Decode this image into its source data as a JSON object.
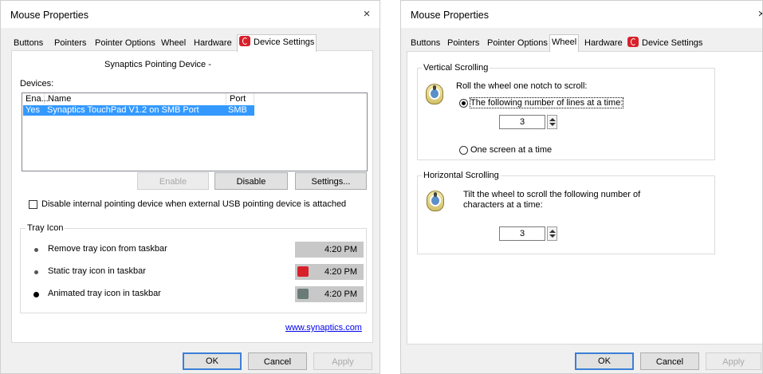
{
  "left": {
    "title": "Mouse Properties",
    "close_glyph": "×",
    "tabs": [
      "Buttons",
      "Pointers",
      "Pointer Options",
      "Wheel",
      "Hardware",
      "Device Settings"
    ],
    "device_title": "Synaptics Pointing Device -",
    "devices_label": "Devices:",
    "columns": [
      "Ena...",
      "Name",
      "Port"
    ],
    "rows": [
      {
        "enabled": "Yes",
        "name": "Synaptics TouchPad V1.2 on SMB Port",
        "port": "SMB"
      }
    ],
    "buttons": {
      "enable": "Enable",
      "disable": "Disable",
      "settings": "Settings..."
    },
    "checkbox_label": "Disable internal pointing device when external USB pointing device is attached",
    "tray_group": "Tray Icon",
    "tray_options": [
      {
        "label": "Remove tray icon from taskbar",
        "time": "4:20 PM",
        "selected": false
      },
      {
        "label": "Static tray icon in taskbar",
        "time": "4:20 PM",
        "selected": false
      },
      {
        "label": "Animated tray icon in taskbar",
        "time": "4:20 PM",
        "selected": true
      }
    ],
    "link": "www.synaptics.com",
    "footer": {
      "ok": "OK",
      "cancel": "Cancel",
      "apply": "Apply"
    }
  },
  "right": {
    "title": "Mouse Properties",
    "tabs": [
      "Buttons",
      "Pointers",
      "Pointer Options",
      "Wheel",
      "Hardware",
      "Device Settings"
    ],
    "vertical_group": "Vertical Scrolling",
    "vertical_desc": "Roll the wheel one notch to scroll:",
    "lines_option": "The following number of lines at a time:",
    "lines_value": "3",
    "one_screen_option": "One screen at a time",
    "horizontal_group": "Horizontal Scrolling",
    "horizontal_desc_1": "Tilt the wheel to scroll the following number of",
    "horizontal_desc_2": "characters at a time:",
    "chars_value": "3",
    "footer": {
      "ok": "OK",
      "cancel": "Cancel",
      "apply": "Apply"
    }
  },
  "colors": {
    "selection": "#3399ff",
    "synaptics_red": "#d8202b",
    "link": "#0000ee",
    "default_button_border": "#3c7fd6"
  },
  "icons": [
    "close-icon",
    "synaptics-icon",
    "mouse-wheel-icon",
    "spin-up-icon",
    "spin-down-icon"
  ]
}
